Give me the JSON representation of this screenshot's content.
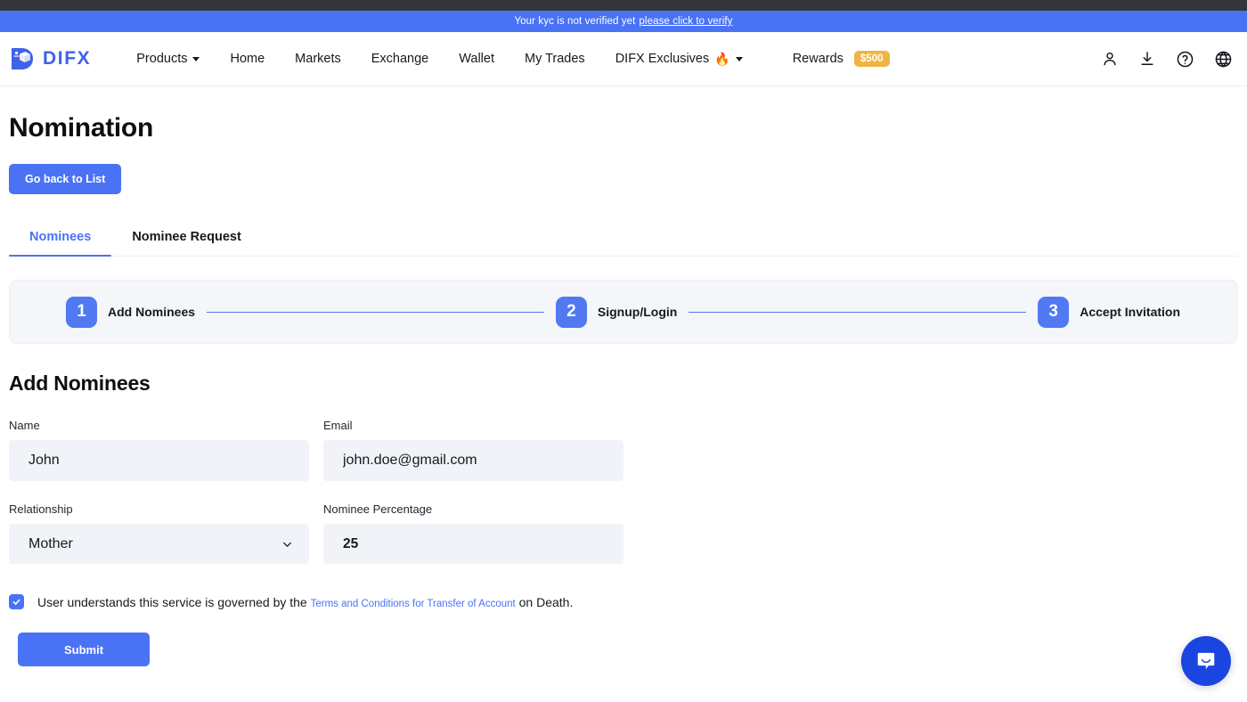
{
  "banner": {
    "text": "Your kyc is not verified yet",
    "link_label": "please click to verify"
  },
  "header": {
    "logo_text": "DIFX",
    "nav_items": [
      {
        "label": "Products",
        "has_caret": true
      },
      {
        "label": "Home",
        "has_caret": false
      },
      {
        "label": "Markets",
        "has_caret": false
      },
      {
        "label": "Exchange",
        "has_caret": false
      },
      {
        "label": "Wallet",
        "has_caret": false
      },
      {
        "label": "My Trades",
        "has_caret": false
      },
      {
        "label": "DIFX Exclusives",
        "has_caret": true,
        "flame": "🔥"
      }
    ],
    "rewards": {
      "label": "Rewards",
      "amount": "$500"
    },
    "icons": [
      "user-icon",
      "download-icon",
      "help-circle-icon",
      "globe-icon"
    ]
  },
  "page": {
    "title": "Nomination",
    "back_button": "Go back to List"
  },
  "tabs": [
    {
      "label": "Nominees",
      "active": true
    },
    {
      "label": "Nominee Request",
      "active": false
    }
  ],
  "stepper": [
    {
      "number": "1",
      "label": "Add Nominees"
    },
    {
      "number": "2",
      "label": "Signup/Login"
    },
    {
      "number": "3",
      "label": "Accept Invitation"
    }
  ],
  "form": {
    "title": "Add Nominees",
    "name": {
      "label": "Name",
      "value": "John",
      "placeholder": "Name"
    },
    "email": {
      "label": "Email",
      "value": "john.doe@gmail.com",
      "placeholder": "Email"
    },
    "relationship": {
      "label": "Relationship",
      "value": "Mother"
    },
    "percentage": {
      "label": "Nominee Percentage",
      "value": "25",
      "placeholder": "Nominee Percentage"
    },
    "terms": {
      "prefix": "User understands this service is governed by the",
      "link": "Terms and Conditions for Transfer of Account",
      "suffix": "on Death.",
      "checked": true
    },
    "submit_label": "Submit"
  },
  "colors": {
    "accent": "#4a72f5",
    "step_badge": "#5079f2",
    "reward_badge": "#f0b441",
    "input_bg": "#f1f3f8",
    "stepper_bg": "#f4f6fa",
    "chat_bg": "#1a45e0",
    "top_strip": "#333639"
  },
  "chat": {
    "icon": "chat-bubble-icon"
  }
}
